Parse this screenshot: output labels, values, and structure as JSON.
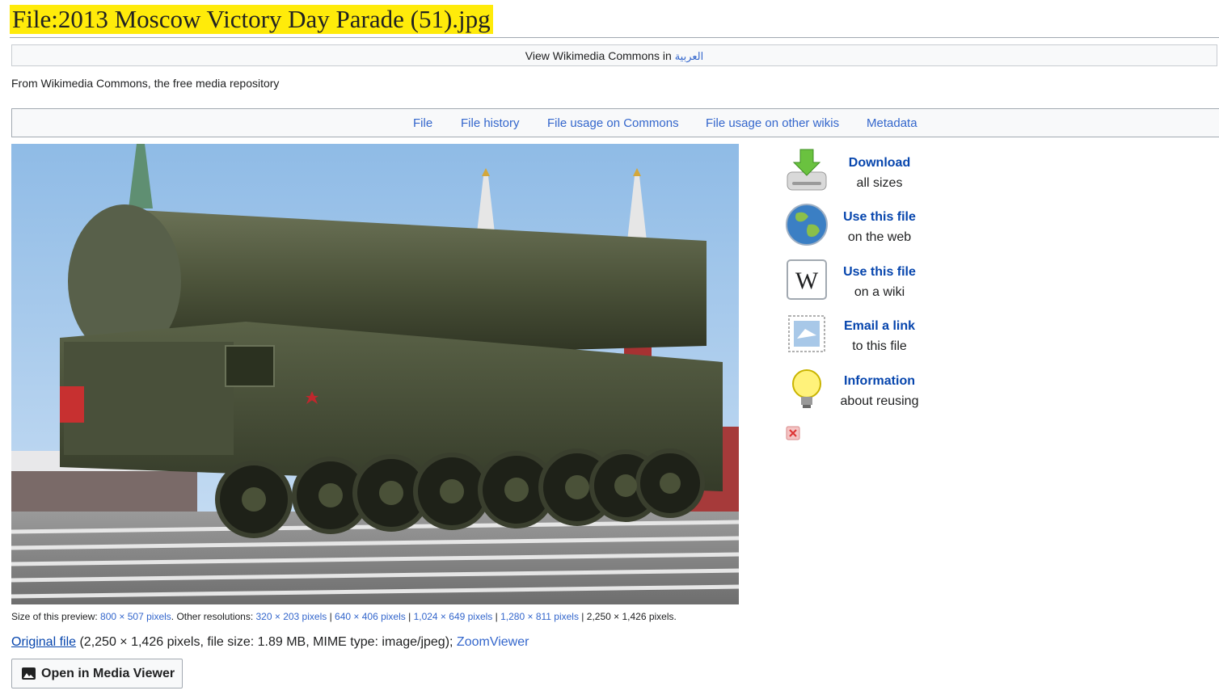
{
  "page": {
    "title": "File:2013 Moscow Victory Day Parade (51).jpg",
    "view_in_prefix": "View Wikimedia Commons in ",
    "view_in_lang": "العربية",
    "from_line": "From Wikimedia Commons, the free media repository"
  },
  "tabs": [
    {
      "label": "File"
    },
    {
      "label": "File history"
    },
    {
      "label": "File usage on Commons"
    },
    {
      "label": "File usage on other wikis"
    },
    {
      "label": "Metadata"
    }
  ],
  "preview_sizes": {
    "prefix": "Size of this preview: ",
    "current": "800 × 507 pixels",
    "middle": ". Other resolutions: ",
    "other": [
      "320 × 203 pixels",
      "640 × 406 pixels",
      "1,024 × 649 pixels",
      "1,280 × 811 pixels",
      "2,250 × 1,426 pixels"
    ],
    "separator": " | ",
    "suffix": "."
  },
  "original": {
    "link": "Original file",
    "details": " (2,250 × 1,426 pixels, file size: 1.89 MB, MIME type: image/jpeg); ",
    "zoom": "ZoomViewer"
  },
  "media_viewer_button": "Open in Media Viewer",
  "sidebar": [
    {
      "bold": "Download",
      "normal": "all sizes",
      "icon": "download-icon"
    },
    {
      "bold": "Use this file",
      "normal": "on the web",
      "icon": "globe-icon"
    },
    {
      "bold": "Use this file",
      "normal": "on a wiki",
      "icon": "wikipedia-icon"
    },
    {
      "bold": "Email a link",
      "normal": "to this file",
      "icon": "email-icon"
    },
    {
      "bold": "Information",
      "normal": "about reusing",
      "icon": "lightbulb-icon"
    }
  ],
  "colors": {
    "title_highlight": "#ffeb0a",
    "link": "#3366cc",
    "visited_link": "#0645ad"
  }
}
